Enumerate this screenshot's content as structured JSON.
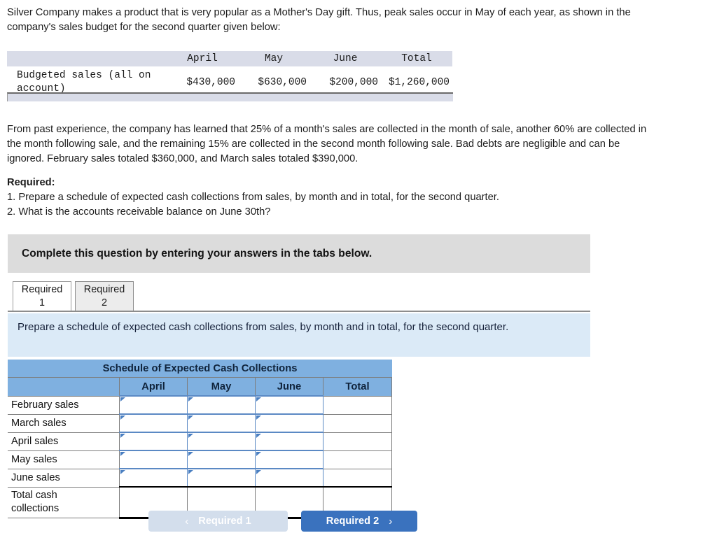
{
  "stem": {
    "paragraph": "Silver Company makes a product that is very popular as a Mother's Day gift. Thus, peak sales occur in May of each year, as shown in the company's sales budget for the second quarter given below:"
  },
  "budget_table": {
    "label_header": "",
    "columns": [
      "April",
      "May",
      "June",
      "Total"
    ],
    "row_label": "Budgeted sales (all on account)",
    "values": [
      "$430,000",
      "$630,000",
      "$200,000",
      "$1,260,000"
    ]
  },
  "experience": {
    "paragraph": "From past experience, the company has learned that 25% of a month's sales are collected in the month of sale, another 60% are collected in the month following sale, and the remaining 15% are collected in the second month following sale. Bad debts are negligible and can be ignored. February sales totaled $360,000, and March sales totaled $390,000."
  },
  "required": {
    "heading": "Required:",
    "item1": "1. Prepare a schedule of expected cash collections from sales, by month and in total, for the second quarter.",
    "item2": "2. What is the accounts receivable balance on June 30th?"
  },
  "banner": {
    "text": "Complete this question by entering your answers in the tabs below."
  },
  "tabs": [
    {
      "line1": "Required",
      "line2": "1",
      "state": "active"
    },
    {
      "line1": "Required",
      "line2": "2",
      "state": "inactive"
    }
  ],
  "req_panel": {
    "text": "Prepare a schedule of expected cash collections from sales, by month and in total, for the second quarter."
  },
  "schedule": {
    "title": "Schedule of Expected Cash Collections",
    "blank_header": "",
    "columns": [
      "April",
      "May",
      "June",
      "Total"
    ],
    "rows": [
      {
        "label": "February sales",
        "april": "",
        "may": "",
        "june": "",
        "total": ""
      },
      {
        "label": "March sales",
        "april": "",
        "may": "",
        "june": "",
        "total": ""
      },
      {
        "label": "April sales",
        "april": "",
        "may": "",
        "june": "",
        "total": ""
      },
      {
        "label": "May sales",
        "april": "",
        "may": "",
        "june": "",
        "total": ""
      },
      {
        "label": "June sales",
        "april": "",
        "may": "",
        "june": "",
        "total": ""
      }
    ],
    "total_row": {
      "label_line1": "Total cash",
      "label_line2": "collections",
      "april": "",
      "may": "",
      "june": "",
      "total": ""
    }
  },
  "nav": {
    "prev_label": "Required 1",
    "next_label": "Required 2",
    "prev_chevron": "‹",
    "next_chevron": "›"
  },
  "colors": {
    "header_blue": "#7fb0e0",
    "panel_blue": "#dbeaf7",
    "banner_gray": "#dcdcdc",
    "budget_header_gray": "#d9dce8",
    "button_blue": "#3a72be",
    "button_disabled": "#d3deec",
    "cell_border_blue": "#5b89c4"
  }
}
